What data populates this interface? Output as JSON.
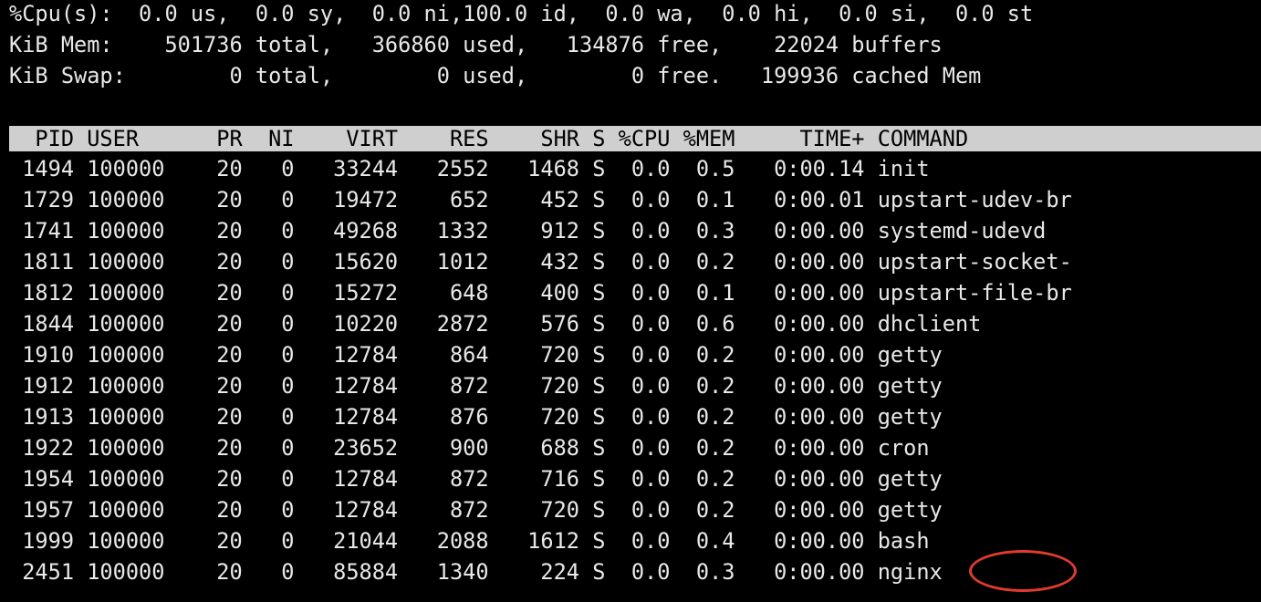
{
  "summary": {
    "cpu": "%Cpu(s):  0.0 us,  0.0 sy,  0.0 ni,100.0 id,  0.0 wa,  0.0 hi,  0.0 si,  0.0 st",
    "mem": "KiB Mem:    501736 total,   366860 used,   134876 free,    22024 buffers",
    "swap": "KiB Swap:        0 total,        0 used,        0 free.   199936 cached Mem"
  },
  "table": {
    "header": "  PID USER      PR  NI    VIRT    RES    SHR S %CPU %MEM     TIME+ COMMAND",
    "rows": [
      " 1494 100000    20   0   33244   2552   1468 S  0.0  0.5   0:00.14 init",
      " 1729 100000    20   0   19472    652    452 S  0.0  0.1   0:00.01 upstart-udev-br",
      " 1741 100000    20   0   49268   1332    912 S  0.0  0.3   0:00.00 systemd-udevd",
      " 1811 100000    20   0   15620   1012    432 S  0.0  0.2   0:00.00 upstart-socket-",
      " 1812 100000    20   0   15272    648    400 S  0.0  0.1   0:00.00 upstart-file-br",
      " 1844 100000    20   0   10220   2872    576 S  0.0  0.6   0:00.00 dhclient",
      " 1910 100000    20   0   12784    864    720 S  0.0  0.2   0:00.00 getty",
      " 1912 100000    20   0   12784    872    720 S  0.0  0.2   0:00.00 getty",
      " 1913 100000    20   0   12784    876    720 S  0.0  0.2   0:00.00 getty",
      " 1922 100000    20   0   23652    900    688 S  0.0  0.2   0:00.00 cron",
      " 1954 100000    20   0   12784    872    716 S  0.0  0.2   0:00.00 getty",
      " 1957 100000    20   0   12784    872    720 S  0.0  0.2   0:00.00 getty",
      " 1999 100000    20   0   21044   2088   1612 S  0.0  0.4   0:00.00 bash",
      " 2451 100000    20   0   85884   1340    224 S  0.0  0.3   0:00.00 nginx"
    ]
  },
  "colors": {
    "background": "#000000",
    "text": "#e8e8e8",
    "header_bar": "#cfcfcf",
    "highlight_ring": "#e03b2c"
  }
}
